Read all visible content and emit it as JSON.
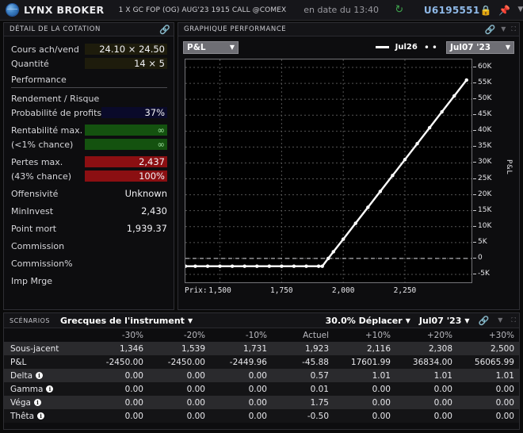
{
  "titlebar": {
    "brand": "LYNX BROKER",
    "contract": "1 X GC FOP (OG) AUG'23 1915 CALL @COMEX",
    "asof": "en date du 13:40",
    "account": "U6195551",
    "sync_icon": "refresh-icon",
    "lock_icon": "lock-icon",
    "pin_icon": "pin-icon",
    "chevron_icon": "chevron-down-icon",
    "minimize": "—",
    "maximize": "⛶",
    "close": "✕"
  },
  "quote_panel": {
    "title": "Détail de la cotation",
    "rows": [
      {
        "label": "Cours ach/vend",
        "value": "24.10 × 24.50",
        "bg": "olive"
      },
      {
        "label": "Quantité",
        "value": "14 × 5",
        "bg": "olive"
      },
      {
        "label": "Rendement / Risque",
        "value": "",
        "bg": "navy"
      },
      {
        "label": "Probabilité de profits",
        "value": "37%",
        "bg": "navy"
      },
      {
        "label": "Rentabilité max.",
        "value": "∞",
        "bg": "green"
      },
      {
        "label": "(<1% chance)",
        "value": "∞",
        "bg": "green"
      },
      {
        "label": "Pertes max.",
        "value": "2,437",
        "bg": "red"
      },
      {
        "label": "(43% chance)",
        "value": "100%",
        "bg": "red"
      },
      {
        "label": "Offensivité",
        "value": "Unknown",
        "bg": "none"
      },
      {
        "label": "MinInvest",
        "value": "2,430",
        "bg": "none"
      },
      {
        "label": "Point mort",
        "value": "1,939.37",
        "bg": "none"
      },
      {
        "label": "Commission",
        "value": "",
        "bg": "none"
      },
      {
        "label": "Commission%",
        "value": "",
        "bg": "none"
      },
      {
        "label": "Imp Mrge",
        "value": "",
        "bg": "none"
      }
    ],
    "section_label": "Performance"
  },
  "chart_panel": {
    "title": "Graphique performance",
    "metric_select": "P&L",
    "date_select": "Jul07 '23",
    "legend_line_label": "Jul26",
    "legend_dots_label": ""
  },
  "chart_data": {
    "type": "line",
    "title": "",
    "xlabel": "Prix:",
    "ylabel": "P&L",
    "xlim": [
      1360,
      2520
    ],
    "ylim": [
      -7500,
      62500
    ],
    "xticks": [
      1500,
      1750,
      2000,
      2250
    ],
    "xtick_labels": [
      "1,500",
      "1,750",
      "2,000",
      "2,250"
    ],
    "yticks": [
      -5000,
      0,
      5000,
      10000,
      15000,
      20000,
      25000,
      30000,
      35000,
      40000,
      45000,
      50000,
      55000,
      60000
    ],
    "ytick_labels": [
      "-5K",
      "0",
      "5K",
      "10K",
      "15K",
      "20K",
      "25K",
      "30K",
      "35K",
      "40K",
      "45K",
      "50K",
      "55K",
      "60K"
    ],
    "grid": true,
    "zero_line": 0,
    "series": [
      {
        "name": "Jul26",
        "style": "line-with-markers",
        "color": "#ffffff",
        "x": [
          1360,
          1400,
          1450,
          1500,
          1550,
          1600,
          1650,
          1700,
          1750,
          1800,
          1850,
          1900,
          1915,
          1939,
          1960,
          2000,
          2050,
          2100,
          2150,
          2200,
          2250,
          2300,
          2350,
          2400,
          2450,
          2500
        ],
        "y": [
          -2450,
          -2450,
          -2450,
          -2450,
          -2450,
          -2450,
          -2450,
          -2450,
          -2450,
          -2450,
          -2450,
          -2450,
          -2450,
          0,
          2100,
          6050,
          11050,
          16050,
          21050,
          26050,
          31050,
          36050,
          41050,
          46050,
          51050,
          56050
        ]
      }
    ]
  },
  "scenarios": {
    "tag": "Scénarios",
    "select": "Grecques de l'instrument",
    "move_select": "30.0% Déplacer",
    "date_select": "Jul07 '23",
    "columns": [
      "",
      "-30%",
      "-20%",
      "-10%",
      "Actuel",
      "+10%",
      "+20%",
      "+30%"
    ],
    "rows": [
      {
        "label": "Sous-jacent",
        "info": false,
        "values": [
          "1,346",
          "1,539",
          "1,731",
          "1,923",
          "2,116",
          "2,308",
          "2,500"
        ]
      },
      {
        "label": "P&L",
        "info": false,
        "values": [
          "-2450.00",
          "-2450.00",
          "-2449.96",
          "-45.88",
          "17601.99",
          "36834.00",
          "56065.99"
        ]
      },
      {
        "label": "Delta",
        "info": true,
        "values": [
          "0.00",
          "0.00",
          "0.00",
          "0.57",
          "1.01",
          "1.01",
          "1.01"
        ]
      },
      {
        "label": "Gamma",
        "info": true,
        "values": [
          "0.00",
          "0.00",
          "0.00",
          "0.01",
          "0.00",
          "0.00",
          "0.00"
        ]
      },
      {
        "label": "Véga",
        "info": true,
        "values": [
          "0.00",
          "0.00",
          "0.00",
          "1.75",
          "0.00",
          "0.00",
          "0.00"
        ]
      },
      {
        "label": "Thêta",
        "info": true,
        "values": [
          "0.00",
          "0.00",
          "0.00",
          "-0.50",
          "0.00",
          "0.00",
          "0.00"
        ]
      }
    ]
  },
  "colors": {
    "accent_green": "#4fc24f",
    "accent_blue": "#8fb9e8",
    "profit_green": "#14520f",
    "loss_red": "#8b0f12",
    "navy": "#0a0a2a",
    "olive": "#1e1c0c"
  }
}
